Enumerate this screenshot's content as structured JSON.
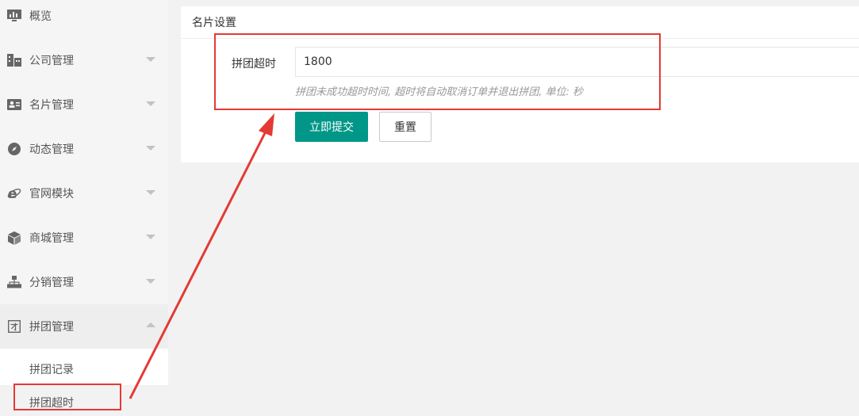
{
  "sidebar": {
    "items": [
      {
        "label": "概览",
        "icon": "chart-icon"
      },
      {
        "label": "公司管理",
        "icon": "building-icon"
      },
      {
        "label": "名片管理",
        "icon": "card-icon"
      },
      {
        "label": "动态管理",
        "icon": "compass-icon"
      },
      {
        "label": "官网模块",
        "icon": "ie-icon"
      },
      {
        "label": "商城管理",
        "icon": "cube-icon"
      },
      {
        "label": "分销管理",
        "icon": "sitemap-icon"
      },
      {
        "label": "拼团管理",
        "icon": "group-icon"
      }
    ],
    "submenu": [
      {
        "label": "拼团记录"
      },
      {
        "label": "拼团超时"
      }
    ]
  },
  "card": {
    "title": "名片设置",
    "field_label": "拼团超时",
    "field_value": "1800",
    "hint": "拼团未成功超时时间, 超时将自动取消订单并退出拼团, 单位: 秒",
    "submit_label": "立即提交",
    "reset_label": "重置"
  },
  "colors": {
    "primary": "#009688",
    "annotation": "#e53935",
    "sidebar_bg": "#f5f5f5"
  }
}
